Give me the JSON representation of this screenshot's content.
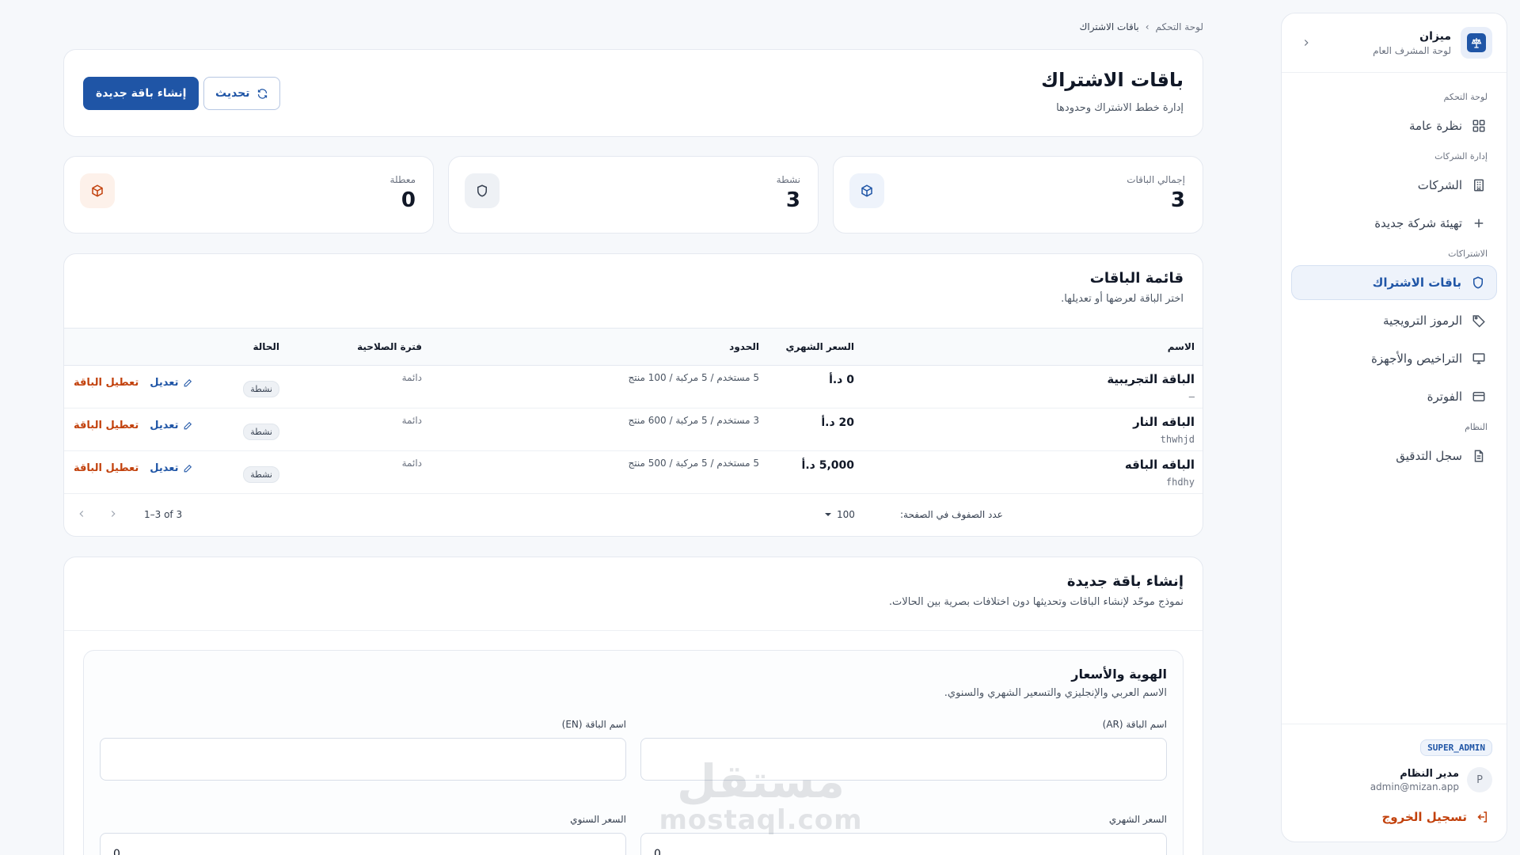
{
  "sidebar": {
    "app_name": "ميزان",
    "app_subtitle": "لوحة المشرف العام",
    "sections": {
      "dashboard": "لوحة التحكم",
      "companies": "إدارة الشركات",
      "subscriptions": "الاشتراكات",
      "system": "النظام"
    },
    "items": {
      "overview": "نظرة عامة",
      "companies": "الشركات",
      "new_company": "تهيئة شركة جديدة",
      "plans": "باقات الاشتراك",
      "promo_codes": "الرموز الترويجية",
      "licenses": "التراخيص والأجهزة",
      "billing": "الفوترة",
      "audit_log": "سجل التدقيق"
    },
    "role_badge": "SUPER_ADMIN",
    "user": {
      "initial": "P",
      "name": "مدير النظام",
      "email": "admin@mizan.app"
    },
    "logout_label": "تسجيل الخروج"
  },
  "breadcrumb": {
    "root": "لوحة التحكم",
    "separator": "›",
    "current": "باقات الاشتراك"
  },
  "header": {
    "title": "باقات الاشتراك",
    "subtitle": "إدارة خطط الاشتراك وحدودها",
    "refresh_label": "تحديث",
    "create_label": "إنشاء باقة جديدة"
  },
  "stats": [
    {
      "label": "إجمالي الباقات",
      "value": "3",
      "icon": "box-icon",
      "color": "#1f55a6",
      "bg": "#eef3fb"
    },
    {
      "label": "نشطة",
      "value": "3",
      "icon": "shield-icon",
      "color": "#374151",
      "bg": "#eef1f5"
    },
    {
      "label": "معطلة",
      "value": "0",
      "icon": "box-icon",
      "color": "#c2410c",
      "bg": "#fdf1ea"
    }
  ],
  "plans_list": {
    "title": "قائمة الباقات",
    "subtitle": "اختر الباقة لعرضها أو تعديلها.",
    "columns": {
      "name": "الاسم",
      "price": "السعر الشهري",
      "limits": "الحدود",
      "validity": "فترة الصلاحية",
      "status": "الحالة"
    },
    "rows": [
      {
        "name": "الباقة التجريبية",
        "code": "—",
        "price": "0 د.أ",
        "limits": "5 مستخدم / 5 مركبة / 100 منتج",
        "validity": "دائمة",
        "status": "نشطة",
        "edit": "تعديل",
        "disable": "تعطيل الباقة"
      },
      {
        "name": "الباقه النار",
        "code": "thwhjd",
        "price": "20 د.أ",
        "limits": "3 مستخدم / 5 مركبة / 600 منتج",
        "validity": "دائمة",
        "status": "نشطة",
        "edit": "تعديل",
        "disable": "تعطيل الباقة"
      },
      {
        "name": "الباقه الباقه",
        "code": "fhdhy",
        "price": "5,000 د.أ",
        "limits": "5 مستخدم / 5 مركبة / 500 منتج",
        "validity": "دائمة",
        "status": "نشطة",
        "edit": "تعديل",
        "disable": "تعطيل الباقة"
      }
    ],
    "pagination": {
      "rows_per_page_label": "عدد الصفوف في الصفحة:",
      "rows_per_page": "100",
      "range": "1–3 of 3"
    }
  },
  "create_form": {
    "title": "إنشاء باقة جديدة",
    "subtitle": "نموذج موحّد لإنشاء الباقات وتحديثها دون اختلافات بصرية بين الحالات.",
    "identity_section": {
      "title": "الهوية والأسعار",
      "subtitle": "الاسم العربي والإنجليزي والتسعير الشهري والسنوي.",
      "name_ar_label": "اسم الباقة (AR)",
      "name_en_label": "اسم الباقة (EN)",
      "monthly_label": "السعر الشهري",
      "yearly_label": "السعر السنوي",
      "monthly_value": "0",
      "yearly_value": "0"
    }
  },
  "watermark": {
    "ar": "مستقل",
    "en": "mostaql.com"
  }
}
